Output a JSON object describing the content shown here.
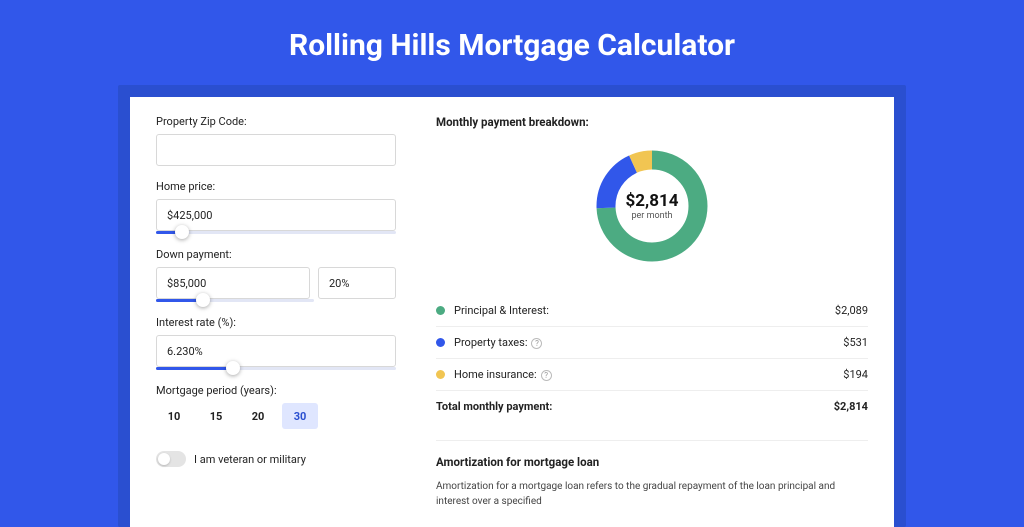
{
  "title": "Rolling Hills Mortgage Calculator",
  "form": {
    "zip_label": "Property Zip Code:",
    "zip_value": "",
    "price_label": "Home price:",
    "price_value": "$425,000",
    "down_label": "Down payment:",
    "down_value": "$85,000",
    "down_pct": "20%",
    "rate_label": "Interest rate (%):",
    "rate_value": "6.230%",
    "period_label": "Mortgage period (years):",
    "periods": [
      "10",
      "15",
      "20",
      "30"
    ],
    "period_selected": "30",
    "vet_label": "I am veteran or military"
  },
  "breakdown": {
    "title": "Monthly payment breakdown:",
    "total_value": "$2,814",
    "per_month": "per month",
    "items": [
      {
        "label": "Principal & Interest:",
        "value": "$2,089",
        "color": "green"
      },
      {
        "label": "Property taxes:",
        "value": "$531",
        "color": "blue",
        "help": true
      },
      {
        "label": "Home insurance:",
        "value": "$194",
        "color": "yellow",
        "help": true
      }
    ],
    "total_label": "Total monthly payment:",
    "total": "$2,814"
  },
  "amort": {
    "title": "Amortization for mortgage loan",
    "text": "Amortization for a mortgage loan refers to the gradual repayment of the loan principal and interest over a specified"
  },
  "chart_data": {
    "type": "pie",
    "title": "Monthly payment breakdown",
    "series": [
      {
        "name": "Principal & Interest",
        "value": 2089,
        "color": "#4cab82"
      },
      {
        "name": "Property taxes",
        "value": 531,
        "color": "#3157ea"
      },
      {
        "name": "Home insurance",
        "value": 194,
        "color": "#f1c552"
      }
    ],
    "total": 2814,
    "center_label": "$2,814",
    "center_sub": "per month"
  }
}
